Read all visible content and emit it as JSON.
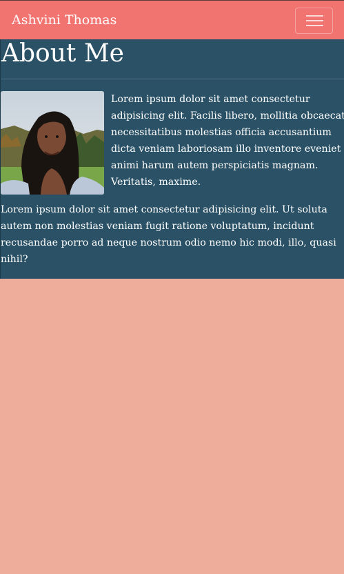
{
  "navbar": {
    "brand": "Ashvini Thomas",
    "menu_icon": "hamburger-menu-icon"
  },
  "about": {
    "title": "About Me",
    "photo_alt": "Portrait photo",
    "paragraph1_lines": [
      "Lorem ipsum dolor sit amet consectetur",
      "adipisicing elit. Facilis libero, mollitia obcaecati",
      "necessitatibus molestias officia accusantium",
      "dicta veniam laboriosam illo inventore eveniet ab",
      "animi harum autem perspiciatis magnam.",
      "Veritatis, maxime."
    ],
    "paragraph2_lines": [
      "Lorem ipsum dolor sit amet consectetur adipisicing elit. Ut soluta",
      "autem non molestias veniam fugit ratione voluptatum, incidunt",
      "recusandae porro ad neque nostrum odio nemo hic modi, illo, quasi",
      "nihil?"
    ]
  },
  "colors": {
    "navbar": "#f17471",
    "section": "#2a5166",
    "page": "#eeac9a"
  }
}
